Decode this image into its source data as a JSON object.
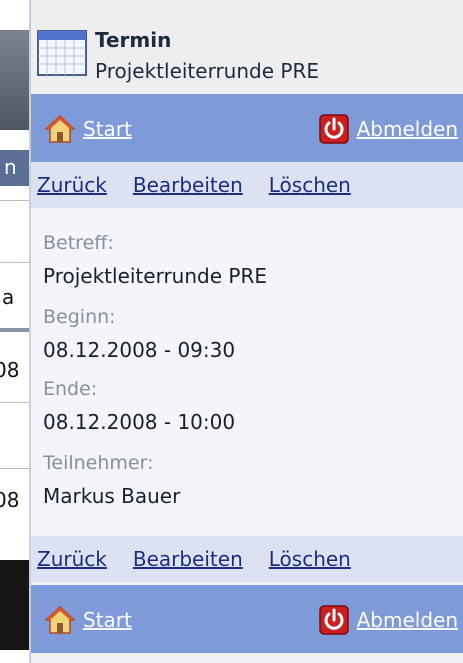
{
  "background_window": {
    "fragments": [
      "n",
      "a",
      "08",
      "08"
    ]
  },
  "header": {
    "icon": "calendar-icon",
    "title": "Termin",
    "subtitle": "Projektleiterrunde PRE"
  },
  "nav": {
    "start_label": "Start",
    "start_icon": "home-icon",
    "logout_label": "Abmelden",
    "logout_icon": "power-icon"
  },
  "actions": {
    "back": "Zurück",
    "edit": "Bearbeiten",
    "delete": "Löschen"
  },
  "details": {
    "subject_label": "Betreff:",
    "subject_value": "Projektleiterrunde PRE",
    "begin_label": "Beginn:",
    "begin_value": "08.12.2008 - 09:30",
    "end_label": "Ende:",
    "end_value": "08.12.2008 - 10:00",
    "participants_label": "Teilnehmer:",
    "participants_value": "Markus Bauer"
  },
  "colors": {
    "navbar": "#7f9ad9",
    "actionbar": "#dde2f3",
    "link": "#1a2e84",
    "label": "#8a8f99",
    "logout_red": "#cc1f1f"
  }
}
